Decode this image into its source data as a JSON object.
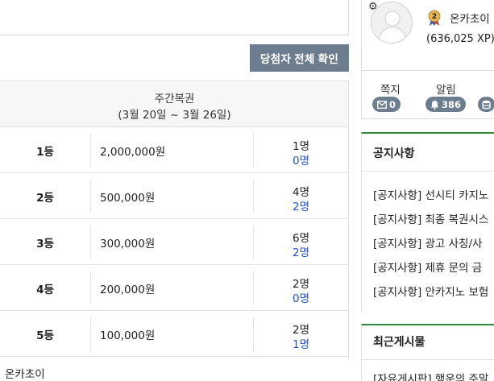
{
  "winners_button_label": "당첨자 전체 확인",
  "table": {
    "header_title": "주간복권",
    "header_period": "(3월 20일 ~ 3월 26일)",
    "rows": [
      {
        "rank": "1등",
        "prize": "2,000,000원",
        "count": "1명",
        "sub": "0명"
      },
      {
        "rank": "2등",
        "prize": "500,000원",
        "count": "4명",
        "sub": "2명"
      },
      {
        "rank": "3등",
        "prize": "300,000원",
        "count": "6명",
        "sub": "2명"
      },
      {
        "rank": "4등",
        "prize": "200,000원",
        "count": "2명",
        "sub": "0명"
      },
      {
        "rank": "5등",
        "prize": "100,000원",
        "count": "2명",
        "sub": "1명"
      }
    ]
  },
  "footer_name": "온카초이",
  "profile": {
    "level": "2",
    "username": "온카초이",
    "xp": "(636,025 XP)"
  },
  "stats": {
    "messages_label": "쪽지",
    "messages_count": "0",
    "alerts_label": "알림",
    "alerts_count": "386"
  },
  "notices": {
    "title": "공지사항",
    "items": [
      "[공지사항] 선시티 카지노",
      "[공지사항] 최종 복권시스",
      "[공지사항] 광고 사칭/사",
      "[공지사항] 제휴 문의 금",
      "[공지사항] 안카지노 보험"
    ]
  },
  "recent": {
    "title": "최근게시물",
    "first_item": "[자유게시판] 행운의 주말"
  },
  "colors": {
    "accent_green": "#2e8b3e",
    "button_gray": "#6d7d90",
    "link_blue": "#1a55e0"
  }
}
